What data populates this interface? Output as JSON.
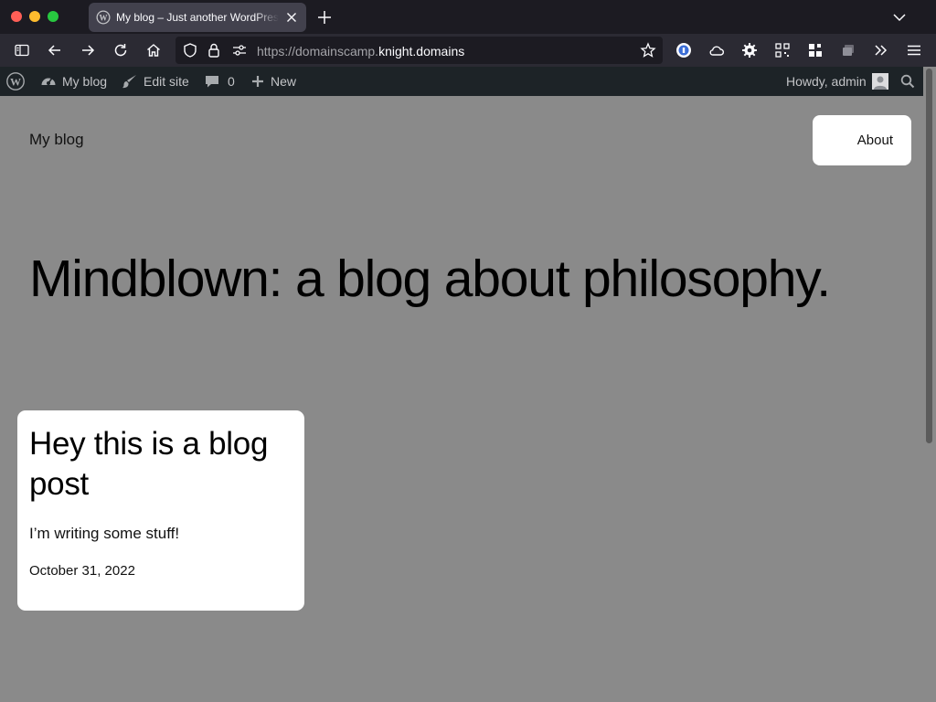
{
  "browser": {
    "tab_title": "My blog – Just another WordPress site",
    "url_prefix": "https://domainscamp.",
    "url_domain": "knight.domains"
  },
  "adminbar": {
    "site_label": "My blog",
    "edit_label": "Edit site",
    "comments_count": "0",
    "new_label": "New",
    "howdy_label": "Howdy, admin"
  },
  "page": {
    "site_title": "My blog",
    "nav_about": "About",
    "tagline": "Mindblown: a blog about philosophy."
  },
  "post": {
    "title": "Hey this is a blog post",
    "excerpt": "I’m writing some stuff!",
    "date": "October 31, 2022"
  },
  "icons": [
    "wordpress-icon",
    "close-icon",
    "plus-icon",
    "chevron-down-icon",
    "sidebar-icon",
    "back-arrow-icon",
    "forward-arrow-icon",
    "reload-icon",
    "home-icon",
    "shield-icon",
    "lock-icon",
    "site-settings-icon",
    "star-icon",
    "extension-icons",
    "overflow-icon",
    "menu-icon",
    "dashboard-icon",
    "brush-icon",
    "comment-icon",
    "avatar-icon",
    "search-icon"
  ],
  "colors": {
    "browser_dark": "#1c1b22",
    "toolbar": "#2b2a33",
    "adminbar": "#1d2327",
    "page_bg": "#8a8a8a"
  }
}
